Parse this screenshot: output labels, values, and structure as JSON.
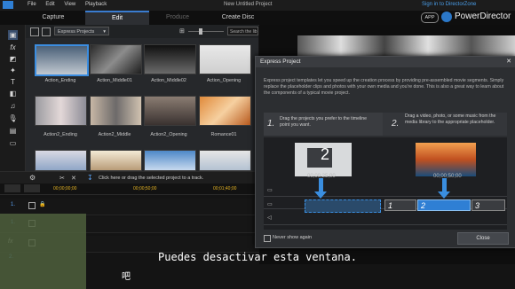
{
  "app": {
    "title": "New Untitled Project",
    "brand": "PowerDirector",
    "signin": "Sign in to DirectorZone",
    "badge": "APP",
    "menu": [
      "File",
      "Edit",
      "View",
      "Playback"
    ],
    "modes": [
      "Capture",
      "Edit",
      "Produce",
      "Create Disc"
    ],
    "active_mode": "Edit"
  },
  "library": {
    "dropdown": "Express Projects",
    "search_placeholder": "Search the lib",
    "items": [
      "Action_Ending",
      "Action_Middle01",
      "Action_Middle02",
      "Action_Opening",
      "Action2_Ending",
      "Action2_Middle",
      "Action2_Opening",
      "Romance01"
    ],
    "hint": "Click here or drag the selected project to a track."
  },
  "timeline": {
    "ruler": [
      "00;00;00;00",
      "00;00;50;00",
      "00;01;40;00"
    ],
    "tracks": [
      "1.",
      "1.",
      "2."
    ]
  },
  "dialog": {
    "title": "Express Project",
    "description": "Express project templates let you speed up the creation process by providing pre-assembled movie segments. Simply replace the placeholder clips and photos with your own media and you're done. This is also a great way to learn about the components of a typical movie project.",
    "step1_num": "1.",
    "step1_text": "Drag the projects you prefer to the timeline point you want.",
    "step2_num": "2.",
    "step2_text": "Drag a video, photo, or some music from the media library to the appropriate placeholder.",
    "ruler1": "00;00;25;00",
    "ruler2": "00;00;50;00",
    "thumb_num": "2",
    "clips": [
      "1",
      "2",
      "3"
    ],
    "checkbox_label": "Never show again",
    "close_label": "Close"
  },
  "subtitle": {
    "text": "Puedes desactivar esta ventana.",
    "fragment": "吧"
  }
}
